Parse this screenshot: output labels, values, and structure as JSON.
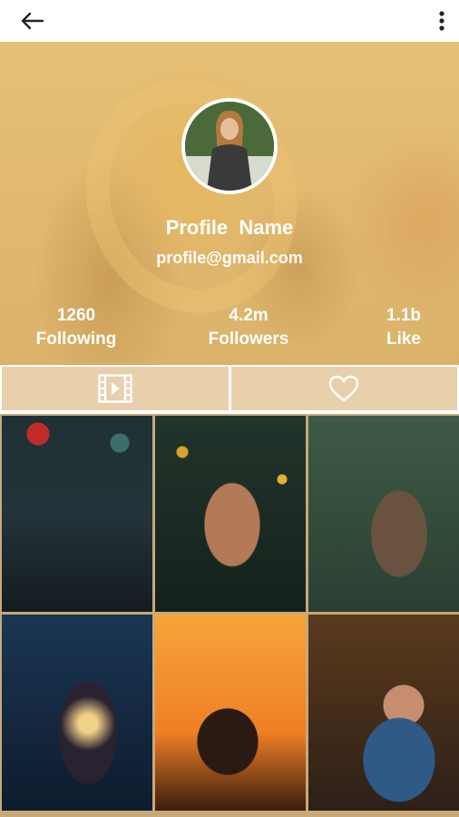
{
  "appbar": {
    "back_icon": "arrow-left-icon",
    "menu_icon": "more-vertical-icon"
  },
  "profile": {
    "name": "Profile  Name",
    "email": "profile@gmail.com",
    "stats": [
      {
        "value": "1260",
        "label": "Following"
      },
      {
        "value": "4.2m",
        "label": "Followers"
      },
      {
        "value": "1.1b",
        "label": "Like"
      }
    ]
  },
  "tabs": [
    {
      "icon": "video-icon"
    },
    {
      "icon": "heart-icon"
    }
  ],
  "grid": {
    "items": [
      {
        "icon": "photo-woman-red-beanie"
      },
      {
        "icon": "photo-woman-autumn-leaves"
      },
      {
        "icon": "photo-woman-green-foliage"
      },
      {
        "icon": "photo-woman-string-lights"
      },
      {
        "icon": "photo-motorcycle-rider-sunset"
      },
      {
        "icon": "photo-woman-blue-sweater"
      }
    ]
  },
  "colors": {
    "header_tint": "#e0b877",
    "text": "#ffffff",
    "appbar_bg": "#ffffff"
  }
}
